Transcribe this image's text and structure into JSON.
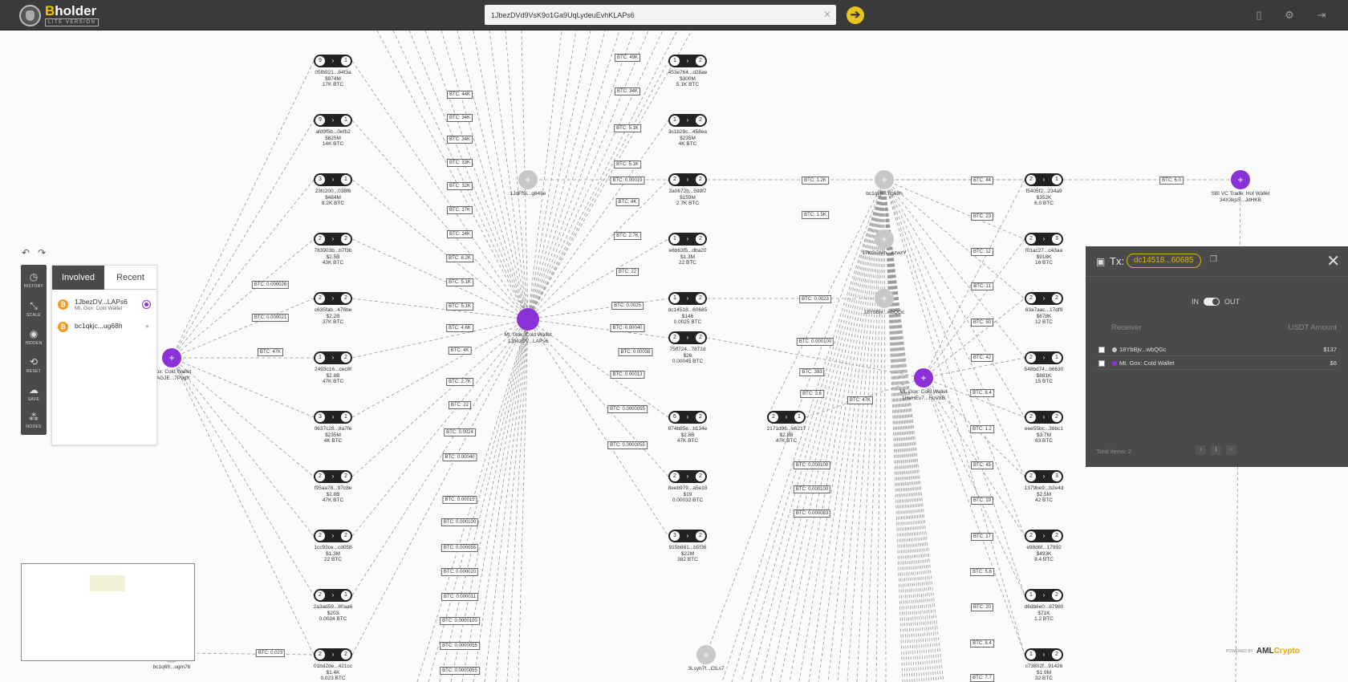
{
  "app": {
    "logo_b": "B",
    "logo_rest": "holder",
    "logo_sub": "LITE VERSION"
  },
  "search": {
    "value": "1JbezDVd9VsK9o1Ga9UqLydeuEvhKLAPs6"
  },
  "topbar_icons": [
    "book-icon",
    "gear-icon",
    "logout-icon"
  ],
  "toolbar": {
    "history": "HISTORY",
    "scale": "SCALE",
    "hidden": "HIDDEN",
    "reset": "RESET",
    "save": "SAVE",
    "nodes": "NODES"
  },
  "left_panel": {
    "tab_involved": "Involved",
    "tab_recent": "Recent",
    "items": [
      {
        "address": "1JbezDV...LAPs6",
        "sub": "Mt. Gox: Cold Wallet"
      },
      {
        "address": "bc1qkjc...ug68h",
        "sub": ""
      }
    ]
  },
  "tx_panel": {
    "label": "Tx:",
    "hash": "dc14518...60685",
    "toggle_in": "IN",
    "toggle_out": "OUT",
    "col_receiver": "Receiver",
    "col_amount": "USDT Amount",
    "rows": [
      {
        "receiver": "18YbBjv...wbQGc",
        "amount": "$137",
        "dot_color": "#c8c8c8"
      },
      {
        "receiver": "Mt. Gox: Cold Wallet",
        "amount": "$6",
        "dot_color": "#8a32d8"
      }
    ],
    "total": "Total items: 2",
    "page": "1"
  },
  "powered": {
    "prefix": "POWERED BY",
    "brand_a": "AML",
    "brand_b": "Crypto"
  },
  "graph": {
    "edge_labels": [
      "BTC: 49K",
      "BTC: 34K",
      "BTC: 5.1K",
      "BTC: 5.1K",
      "BTC: 0.00019",
      "BTC: 4K",
      "BTC: 2.7K",
      "BTC: 22",
      "BTC: 0.0025",
      "BTC: 0.00040",
      "BTC: 0.00038",
      "BTC: 0.00013",
      "BTC: 0.0000055",
      "BTC: 0.0000055",
      "BTC: 44K",
      "BTC: 34K",
      "BTC: 34K",
      "BTC: 33K",
      "BTC: 32K",
      "BTC: 17K",
      "BTC: 14K",
      "BTC: 8.2K",
      "BTC: 5.1K",
      "BTC: 5.1K",
      "BTC: 4.6K",
      "BTC: 4K",
      "BTC: 2.7K",
      "BTC: 22",
      "BTC: 0.0024",
      "BTC: 0.00040",
      "BTC: 0.00015",
      "BTC: 0.000100",
      "BTC: 0.000055",
      "BTC: 0.000020",
      "BTC: 0.000011",
      "BTC: 0.0000100",
      "BTC: 0.0000055",
      "BTC: 0.0000055",
      "BTC: 0.000026",
      "BTC: 0.000021",
      "BTC: 47K",
      "BTC: 0.023",
      "BTC: 1.2K",
      "BTC: 1.5K",
      "BTC: 0.0023",
      "BTC: 0.000100",
      "BTC: 393",
      "BTC: 3.6",
      "BTC: 47K",
      "BTC: 0.000100",
      "BTC: 0.000100",
      "BTC: 0.000083",
      "BTC: 44",
      "BTC: 6.0",
      "BTC: 23",
      "BTC: 12",
      "BTC: 11",
      "BTC: 50",
      "BTC: 42",
      "BTC: 8.4",
      "BTC: 1.2",
      "BTC: 45",
      "BTC: 19",
      "BTC: 17",
      "BTC: 5.6",
      "BTC: 20",
      "BTC: 8.4",
      "BTC: 7.7"
    ],
    "tx_nodes": [
      {
        "l": "9",
        "r": "1",
        "lines": [
          "05fb921...84f3a",
          "$974M",
          "17K BTC"
        ]
      },
      {
        "l": "9",
        "r": "1",
        "lines": [
          "afd9f5b...0efb2",
          "$825M",
          "14K BTC"
        ]
      },
      {
        "l": "3",
        "r": "1",
        "lines": [
          "23fc200...038f6",
          "$484M",
          "8.2K BTC"
        ]
      },
      {
        "l": "2",
        "r": "2",
        "lines": [
          "783903b...b7f3b",
          "$2.5B",
          "43K BTC"
        ]
      },
      {
        "l": "2",
        "r": "2",
        "lines": [
          "c635fab...476be",
          "$2.2B",
          "37K BTC"
        ]
      },
      {
        "l": "1",
        "r": "2",
        "lines": [
          "2493c16...cec8f",
          "$2.8B",
          "47K BTC"
        ]
      },
      {
        "l": "3",
        "r": "1",
        "lines": [
          "0637c28...8a7fe",
          "$235M",
          "4K BTC"
        ]
      },
      {
        "l": "2",
        "r": "2",
        "lines": [
          "f95aa78...97c8e",
          "$2.8B",
          "47K BTC"
        ]
      },
      {
        "l": "2",
        "r": "2",
        "lines": [
          "1cc93ce...cd058",
          "$1.3M",
          "22 BTC"
        ]
      },
      {
        "l": "2",
        "r": "1",
        "lines": [
          "2a3ad59...80aa6",
          "$203",
          "0.0034 BTC"
        ]
      },
      {
        "l": "2",
        "r": "2",
        "lines": [
          "01bd2de...421cc",
          "$1.4K",
          "0.023 BTC"
        ]
      },
      {
        "l": "1",
        "r": "2",
        "lines": [
          "453e764...d28ae",
          "$300M",
          "5.1K BTC"
        ]
      },
      {
        "l": "1",
        "r": "2",
        "lines": [
          "3c1b29c...458ea",
          "$235M",
          "4K BTC"
        ]
      },
      {
        "l": "2",
        "r": "2",
        "lines": [
          "3a0672b...599f7",
          "$159M",
          "2.7K BTC"
        ]
      },
      {
        "l": "1",
        "r": "2",
        "lines": [
          "e6b63f5...dba20",
          "$1.3M",
          "22 BTC"
        ]
      },
      {
        "l": "1",
        "r": "2",
        "lines": [
          "dc14518...60685",
          "$146",
          "0.0025 BTC"
        ]
      },
      {
        "l": "2",
        "r": "2",
        "lines": [
          "75ff724...7872d",
          "$26",
          "0.00045 BTC"
        ]
      },
      {
        "l": "6",
        "r": "2",
        "lines": [
          "874b85e...b134e",
          "$2.8B",
          "47K BTC"
        ]
      },
      {
        "l": "2",
        "r": "2",
        "lines": [
          "8eeb979...a5e18",
          "$19",
          "0.00032 BTC"
        ]
      },
      {
        "l": "3",
        "r": "2",
        "lines": [
          "915b861...b5f36",
          "$22M",
          "382 BTC"
        ]
      },
      {
        "l": "2",
        "r": "1",
        "lines": [
          "2171d96...e6217",
          "$2.8B",
          "47K BTC"
        ]
      },
      {
        "l": "2",
        "r": "1",
        "lines": [
          "f5405f2...234a9",
          "$352K",
          "6.0 BTC"
        ]
      },
      {
        "l": "2",
        "r": "3",
        "lines": [
          "f01ac27...c43aa",
          "$918K",
          "16 BTC"
        ]
      },
      {
        "l": "2",
        "r": "2",
        "lines": [
          "63a7aac...17df9",
          "$678K",
          "12 BTC"
        ]
      },
      {
        "l": "2",
        "r": "1",
        "lines": [
          "548bd74...b6630",
          "$881K",
          "15 BTC"
        ]
      },
      {
        "l": "2",
        "r": "2",
        "lines": [
          "eee55bc...38bc1",
          "$3.7M",
          "63 BTC"
        ]
      },
      {
        "l": "2",
        "r": "3",
        "lines": [
          "1379be9...b2e4d",
          "$2.5M",
          "42 BTC"
        ]
      },
      {
        "l": "2",
        "r": "2",
        "lines": [
          "e98d6f...17992",
          "$493K",
          "8.4 BTC"
        ]
      },
      {
        "l": "1",
        "r": "2",
        "lines": [
          "d6db8e0...87980",
          "$71K",
          "1.2 BTC"
        ]
      },
      {
        "l": "1",
        "r": "2",
        "lines": [
          "c73802f...91426",
          "$1.9M",
          "32 BTC"
        ]
      }
    ],
    "addr_nodes": [
      {
        "lines": [
          "Gox: Cold Wallet",
          "eAGJE...7P9gX"
        ]
      },
      {
        "lines": [
          "1JdFf9i...g849e"
        ]
      },
      {
        "lines": [
          "Mt. Gox: Cold Wallet",
          "1JbezDV...LAPs6"
        ]
      },
      {
        "lines": [
          "bc1qkjc...ug68h"
        ]
      },
      {
        "lines": [
          "17KGGMh...azwzY"
        ]
      },
      {
        "lines": [
          "18YbBjv...wbQGc"
        ]
      },
      {
        "lines": [
          "Mt. Gox: Cold Wallet",
          "1HeHEv7...HoV8B"
        ]
      },
      {
        "lines": [
          "SBI VC Trade: Hot Wallet",
          "34X3kpS...JdHKB"
        ]
      },
      {
        "lines": [
          "bc1q6fr...ugm76"
        ]
      },
      {
        "lines": [
          "3Lsyh7f...CtLs7"
        ]
      }
    ]
  }
}
